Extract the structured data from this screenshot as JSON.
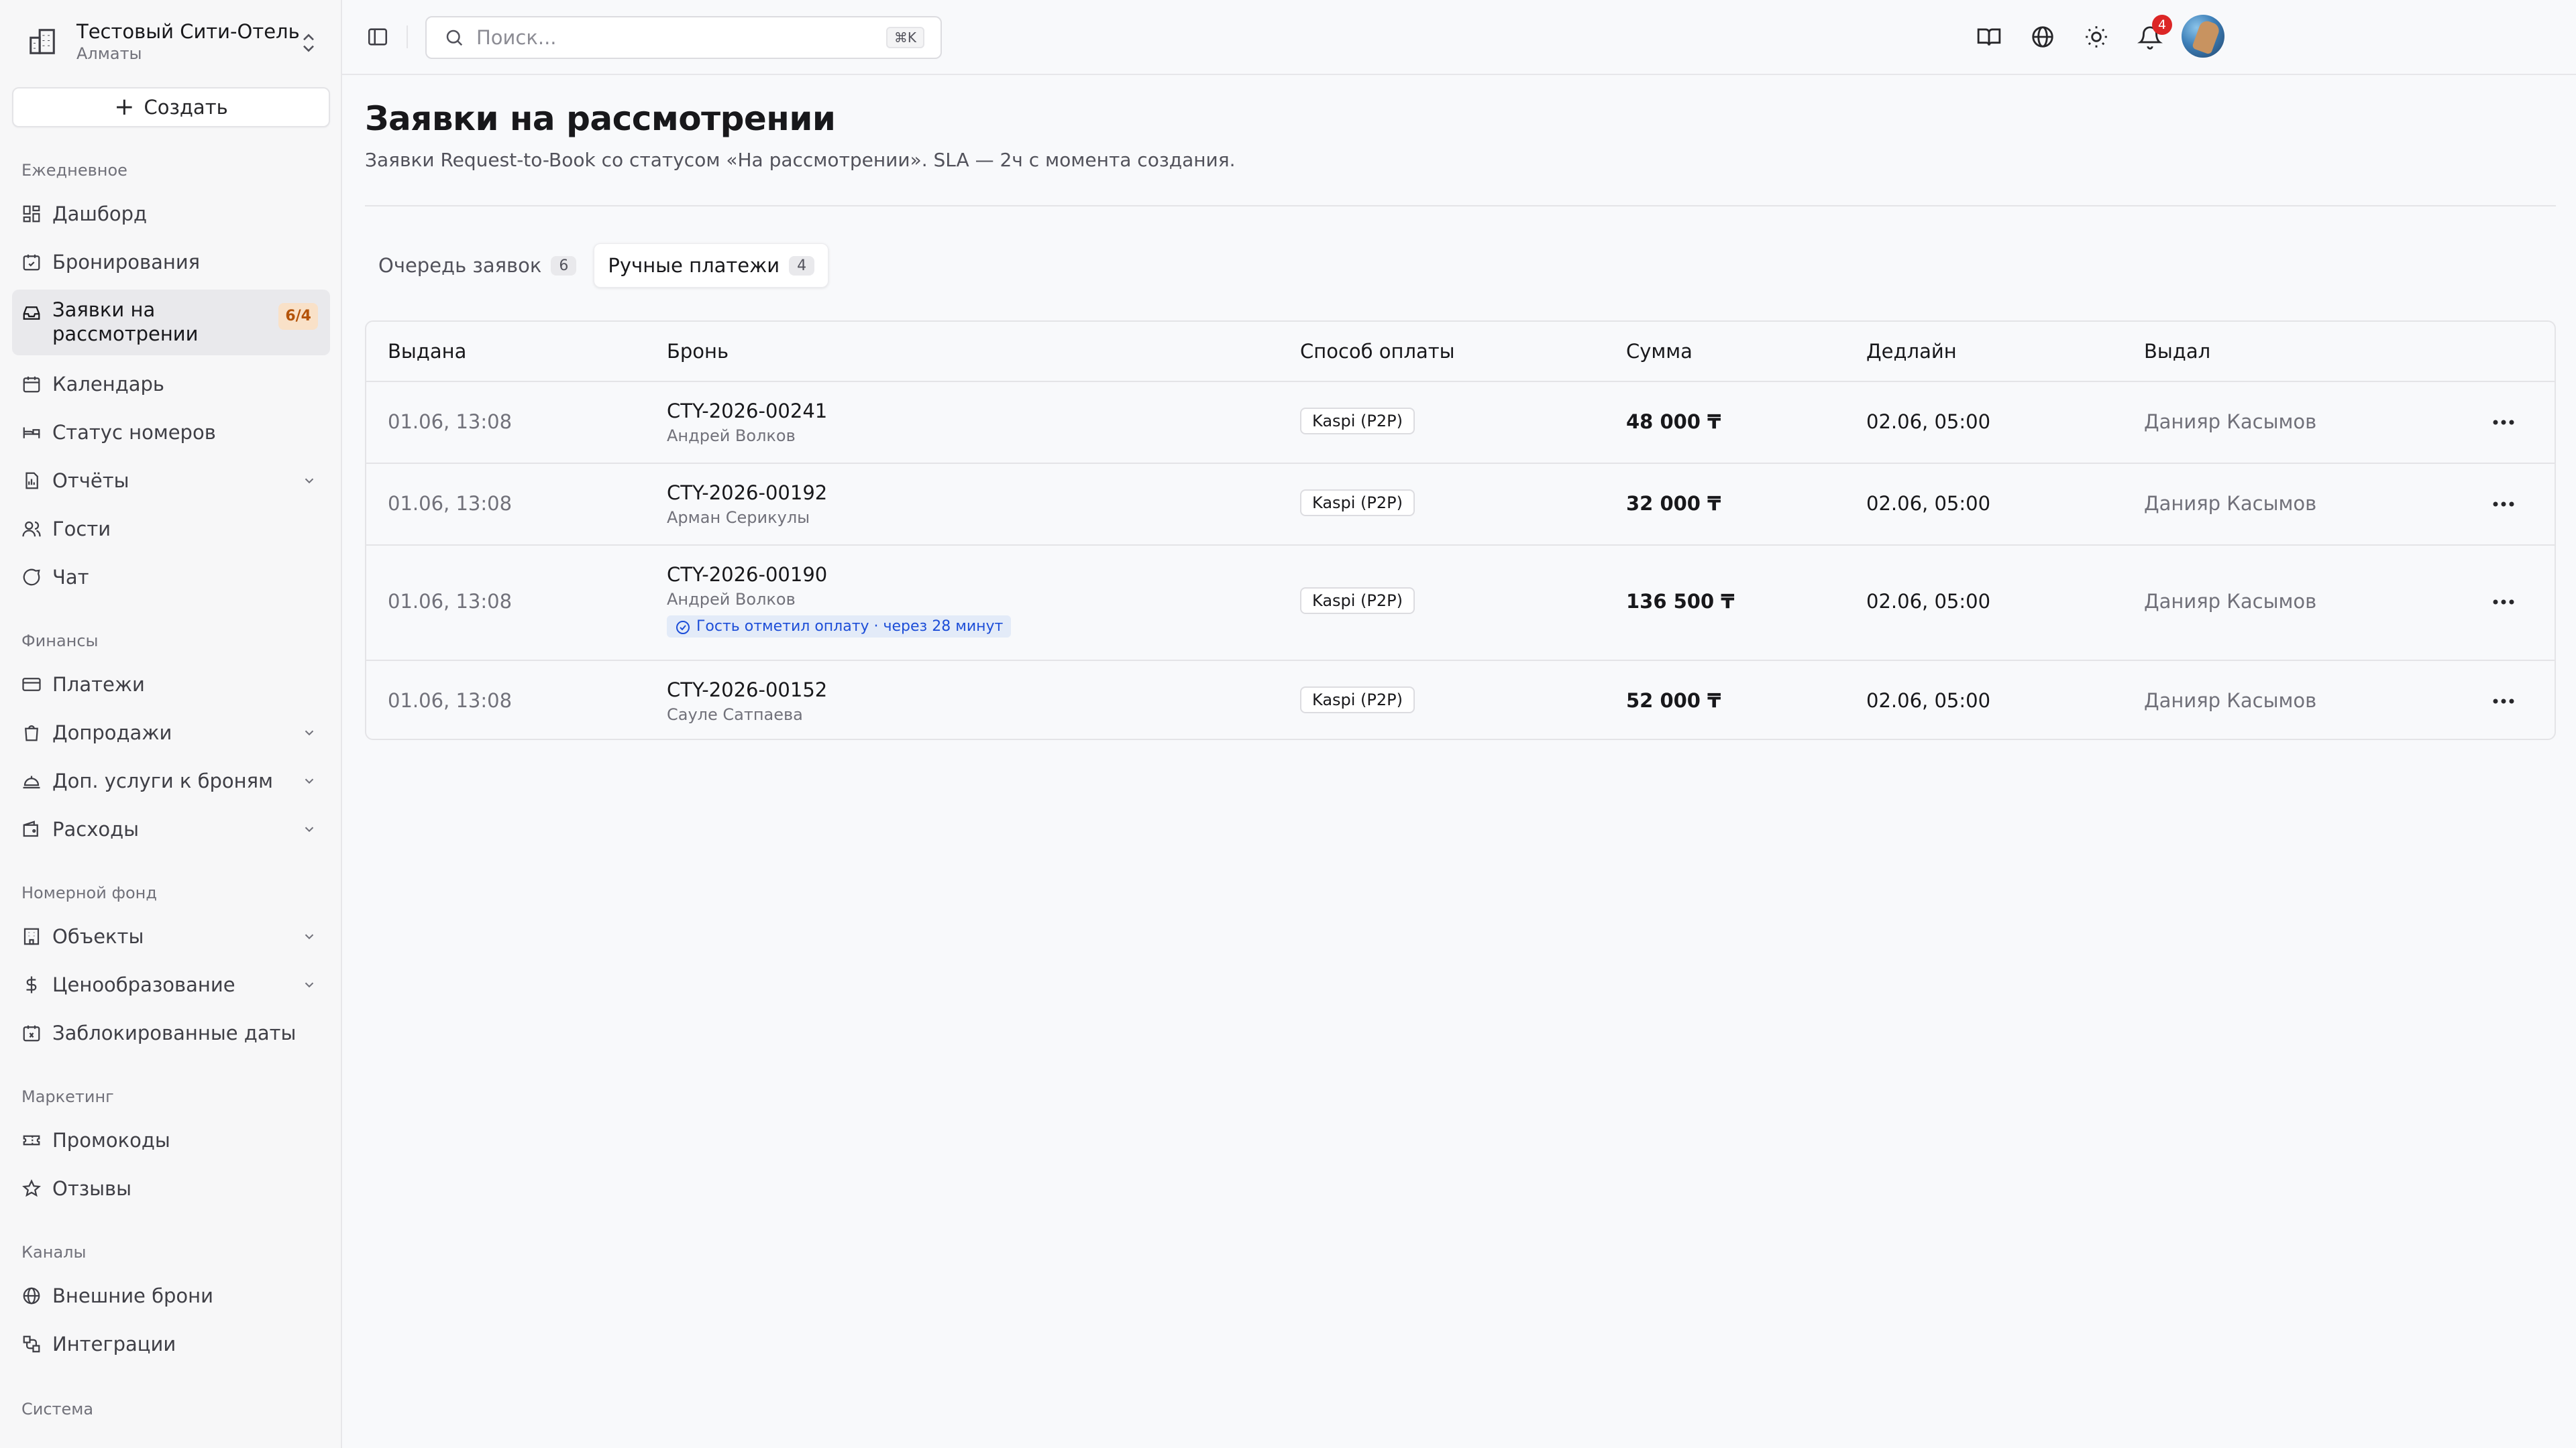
{
  "hotel": {
    "name": "Тестовый Сити-Отель",
    "city": "Алматы"
  },
  "sidebar": {
    "create_label": "Создать",
    "sections": [
      {
        "title": "Ежедневное"
      },
      {
        "title": "Финансы"
      },
      {
        "title": "Номерной фонд"
      },
      {
        "title": "Маркетинг"
      },
      {
        "title": "Каналы"
      },
      {
        "title": "Система"
      }
    ],
    "items": [
      {
        "label": "Дашборд",
        "icon": "dashboard-icon"
      },
      {
        "label": "Бронирования",
        "icon": "calendar-check-icon"
      },
      {
        "label": "Заявки на\nрассмотрении",
        "icon": "inbox-icon",
        "badge": "6/4",
        "active": true
      },
      {
        "label": "Календарь",
        "icon": "calendar-icon"
      },
      {
        "label": "Статус номеров",
        "icon": "bed-icon"
      },
      {
        "label": "Отчёты",
        "icon": "report-icon",
        "expandable": true
      },
      {
        "label": "Гости",
        "icon": "users-icon"
      },
      {
        "label": "Чат",
        "icon": "chat-icon"
      },
      {
        "label": "Платежи",
        "icon": "credit-card-icon"
      },
      {
        "label": "Допродажи",
        "icon": "shopping-bag-icon",
        "expandable": true
      },
      {
        "label": "Доп. услуги к броням",
        "icon": "concierge-bell-icon",
        "expandable": true
      },
      {
        "label": "Расходы",
        "icon": "wallet-icon",
        "expandable": true
      },
      {
        "label": "Объекты",
        "icon": "building-icon",
        "expandable": true
      },
      {
        "label": "Ценообразование",
        "icon": "dollar-icon",
        "expandable": true
      },
      {
        "label": "Заблокированные даты",
        "icon": "calendar-x-icon"
      },
      {
        "label": "Промокоды",
        "icon": "ticket-icon"
      },
      {
        "label": "Отзывы",
        "icon": "star-icon"
      },
      {
        "label": "Внешние брони",
        "icon": "globe-icon"
      },
      {
        "label": "Интеграции",
        "icon": "plug-icon"
      }
    ]
  },
  "topbar": {
    "search_placeholder": "Поиск...",
    "search_shortcut": "⌘K",
    "notification_count": "4"
  },
  "page": {
    "title": "Заявки на рассмотрении",
    "subtitle": "Заявки Request-to-Book со статусом «На рассмотрении». SLA — 2ч с момента создания.",
    "tabs": [
      {
        "label": "Очередь заявок",
        "count": "6"
      },
      {
        "label": "Ручные платежи",
        "count": "4",
        "active": true
      }
    ]
  },
  "table": {
    "headers": [
      "Выдана",
      "Бронь",
      "Способ оплаты",
      "Сумма",
      "Дедлайн",
      "Выдал"
    ],
    "rows": [
      {
        "issued": "01.06, 13:08",
        "booking": "CTY-2026-00241",
        "guest": "Андрей Волков",
        "method": "Kaspi (P2P)",
        "amount": "48 000 ₸",
        "deadline": "02.06, 05:00",
        "issued_by": "Данияр Касымов"
      },
      {
        "issued": "01.06, 13:08",
        "booking": "CTY-2026-00192",
        "guest": "Арман Серикулы",
        "method": "Kaspi (P2P)",
        "amount": "32 000 ₸",
        "deadline": "02.06, 05:00",
        "issued_by": "Данияр Касымов"
      },
      {
        "issued": "01.06, 13:08",
        "booking": "CTY-2026-00190",
        "guest": "Андрей Волков",
        "note": "Гость отметил оплату · через 28 минут",
        "method": "Kaspi (P2P)",
        "amount": "136 500 ₸",
        "deadline": "02.06, 05:00",
        "issued_by": "Данияр Касымов"
      },
      {
        "issued": "01.06, 13:08",
        "booking": "CTY-2026-00152",
        "guest": "Сауле Сатпаева",
        "method": "Kaspi (P2P)",
        "amount": "52 000 ₸",
        "deadline": "02.06, 05:00",
        "issued_by": "Данияр Касымов"
      }
    ]
  },
  "colors": {
    "badge_bg": "#f9e1c8",
    "badge_text": "#b45309",
    "note_bg": "#e3ebf8",
    "note_text": "#1d4ed8",
    "notif": "#dc2626"
  }
}
